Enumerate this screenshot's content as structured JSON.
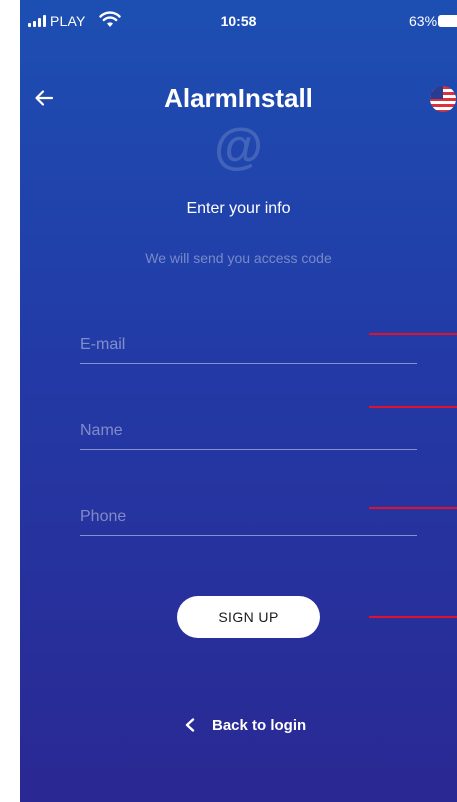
{
  "status_bar": {
    "carrier": "PLAY",
    "time": "10:58",
    "battery": "63%"
  },
  "header": {
    "title": "AlarmInstall",
    "back_icon": "back-arrow-icon",
    "language_icon": "us-flag-icon"
  },
  "form": {
    "hero_icon": "at-sign-icon",
    "hero_glyph": "@",
    "heading": "Enter your info",
    "subheading": "We will send you access code",
    "email_placeholder": "E-mail",
    "name_placeholder": "Name",
    "phone_placeholder": "Phone",
    "submit_label": "SIGN UP"
  },
  "footer": {
    "back_to_login_label": "Back to login"
  },
  "colors": {
    "background_top": "#1d4fb2",
    "background_bottom": "#2a2893",
    "annotation_line": "#e0112b"
  }
}
